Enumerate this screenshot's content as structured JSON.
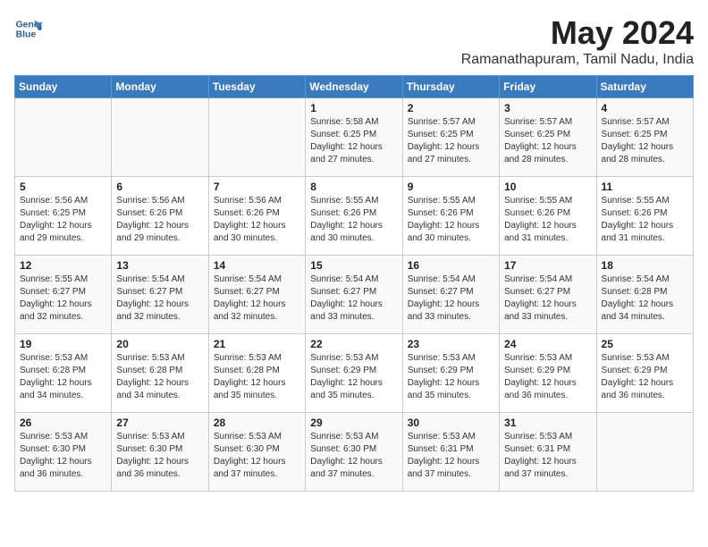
{
  "header": {
    "logo_line1": "General",
    "logo_line2": "Blue",
    "title": "May 2024",
    "location": "Ramanathapuram, Tamil Nadu, India"
  },
  "weekdays": [
    "Sunday",
    "Monday",
    "Tuesday",
    "Wednesday",
    "Thursday",
    "Friday",
    "Saturday"
  ],
  "weeks": [
    [
      {
        "day": "",
        "text": ""
      },
      {
        "day": "",
        "text": ""
      },
      {
        "day": "",
        "text": ""
      },
      {
        "day": "1",
        "text": "Sunrise: 5:58 AM\nSunset: 6:25 PM\nDaylight: 12 hours\nand 27 minutes."
      },
      {
        "day": "2",
        "text": "Sunrise: 5:57 AM\nSunset: 6:25 PM\nDaylight: 12 hours\nand 27 minutes."
      },
      {
        "day": "3",
        "text": "Sunrise: 5:57 AM\nSunset: 6:25 PM\nDaylight: 12 hours\nand 28 minutes."
      },
      {
        "day": "4",
        "text": "Sunrise: 5:57 AM\nSunset: 6:25 PM\nDaylight: 12 hours\nand 28 minutes."
      }
    ],
    [
      {
        "day": "5",
        "text": "Sunrise: 5:56 AM\nSunset: 6:25 PM\nDaylight: 12 hours\nand 29 minutes."
      },
      {
        "day": "6",
        "text": "Sunrise: 5:56 AM\nSunset: 6:26 PM\nDaylight: 12 hours\nand 29 minutes."
      },
      {
        "day": "7",
        "text": "Sunrise: 5:56 AM\nSunset: 6:26 PM\nDaylight: 12 hours\nand 30 minutes."
      },
      {
        "day": "8",
        "text": "Sunrise: 5:55 AM\nSunset: 6:26 PM\nDaylight: 12 hours\nand 30 minutes."
      },
      {
        "day": "9",
        "text": "Sunrise: 5:55 AM\nSunset: 6:26 PM\nDaylight: 12 hours\nand 30 minutes."
      },
      {
        "day": "10",
        "text": "Sunrise: 5:55 AM\nSunset: 6:26 PM\nDaylight: 12 hours\nand 31 minutes."
      },
      {
        "day": "11",
        "text": "Sunrise: 5:55 AM\nSunset: 6:26 PM\nDaylight: 12 hours\nand 31 minutes."
      }
    ],
    [
      {
        "day": "12",
        "text": "Sunrise: 5:55 AM\nSunset: 6:27 PM\nDaylight: 12 hours\nand 32 minutes."
      },
      {
        "day": "13",
        "text": "Sunrise: 5:54 AM\nSunset: 6:27 PM\nDaylight: 12 hours\nand 32 minutes."
      },
      {
        "day": "14",
        "text": "Sunrise: 5:54 AM\nSunset: 6:27 PM\nDaylight: 12 hours\nand 32 minutes."
      },
      {
        "day": "15",
        "text": "Sunrise: 5:54 AM\nSunset: 6:27 PM\nDaylight: 12 hours\nand 33 minutes."
      },
      {
        "day": "16",
        "text": "Sunrise: 5:54 AM\nSunset: 6:27 PM\nDaylight: 12 hours\nand 33 minutes."
      },
      {
        "day": "17",
        "text": "Sunrise: 5:54 AM\nSunset: 6:27 PM\nDaylight: 12 hours\nand 33 minutes."
      },
      {
        "day": "18",
        "text": "Sunrise: 5:54 AM\nSunset: 6:28 PM\nDaylight: 12 hours\nand 34 minutes."
      }
    ],
    [
      {
        "day": "19",
        "text": "Sunrise: 5:53 AM\nSunset: 6:28 PM\nDaylight: 12 hours\nand 34 minutes."
      },
      {
        "day": "20",
        "text": "Sunrise: 5:53 AM\nSunset: 6:28 PM\nDaylight: 12 hours\nand 34 minutes."
      },
      {
        "day": "21",
        "text": "Sunrise: 5:53 AM\nSunset: 6:28 PM\nDaylight: 12 hours\nand 35 minutes."
      },
      {
        "day": "22",
        "text": "Sunrise: 5:53 AM\nSunset: 6:29 PM\nDaylight: 12 hours\nand 35 minutes."
      },
      {
        "day": "23",
        "text": "Sunrise: 5:53 AM\nSunset: 6:29 PM\nDaylight: 12 hours\nand 35 minutes."
      },
      {
        "day": "24",
        "text": "Sunrise: 5:53 AM\nSunset: 6:29 PM\nDaylight: 12 hours\nand 36 minutes."
      },
      {
        "day": "25",
        "text": "Sunrise: 5:53 AM\nSunset: 6:29 PM\nDaylight: 12 hours\nand 36 minutes."
      }
    ],
    [
      {
        "day": "26",
        "text": "Sunrise: 5:53 AM\nSunset: 6:30 PM\nDaylight: 12 hours\nand 36 minutes."
      },
      {
        "day": "27",
        "text": "Sunrise: 5:53 AM\nSunset: 6:30 PM\nDaylight: 12 hours\nand 36 minutes."
      },
      {
        "day": "28",
        "text": "Sunrise: 5:53 AM\nSunset: 6:30 PM\nDaylight: 12 hours\nand 37 minutes."
      },
      {
        "day": "29",
        "text": "Sunrise: 5:53 AM\nSunset: 6:30 PM\nDaylight: 12 hours\nand 37 minutes."
      },
      {
        "day": "30",
        "text": "Sunrise: 5:53 AM\nSunset: 6:31 PM\nDaylight: 12 hours\nand 37 minutes."
      },
      {
        "day": "31",
        "text": "Sunrise: 5:53 AM\nSunset: 6:31 PM\nDaylight: 12 hours\nand 37 minutes."
      },
      {
        "day": "",
        "text": ""
      }
    ]
  ]
}
